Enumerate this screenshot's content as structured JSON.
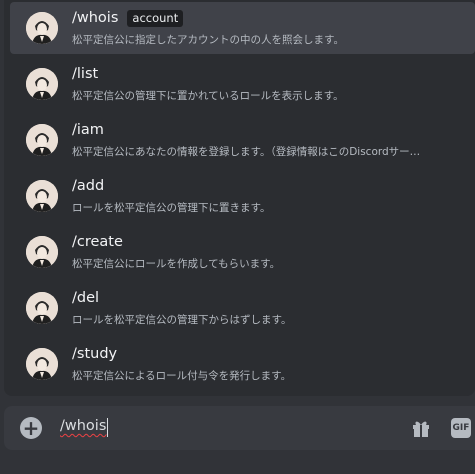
{
  "commands": [
    {
      "name": "/whois",
      "option": "account",
      "description": "松平定信公に指定したアカウントの中の人を照会します。",
      "selected": true
    },
    {
      "name": "/list",
      "option": "",
      "description": "松平定信公の管理下に置かれているロールを表示します。",
      "selected": false
    },
    {
      "name": "/iam",
      "option": "",
      "description": "松平定信公にあなたの情報を登録します。（登録情報はこのDiscordサー…",
      "selected": false
    },
    {
      "name": "/add",
      "option": "",
      "description": "ロールを松平定信公の管理下に置きます。",
      "selected": false
    },
    {
      "name": "/create",
      "option": "",
      "description": "松平定信公にロールを作成してもらいます。",
      "selected": false
    },
    {
      "name": "/del",
      "option": "",
      "description": "ロールを松平定信公の管理下からはずします。",
      "selected": false
    },
    {
      "name": "/study",
      "option": "",
      "description": "松平定信公によるロール付与令を発行します。",
      "selected": false
    }
  ],
  "composer": {
    "value": "/whois",
    "plus_icon": "plus-circle-icon",
    "gift_icon": "gift-icon",
    "gif_label": "GIF"
  },
  "colors": {
    "background": "#313338",
    "popup": "#2b2d31",
    "selected_row": "#404249",
    "composer": "#383a40",
    "spellcheck_underline": "#ed4245"
  }
}
